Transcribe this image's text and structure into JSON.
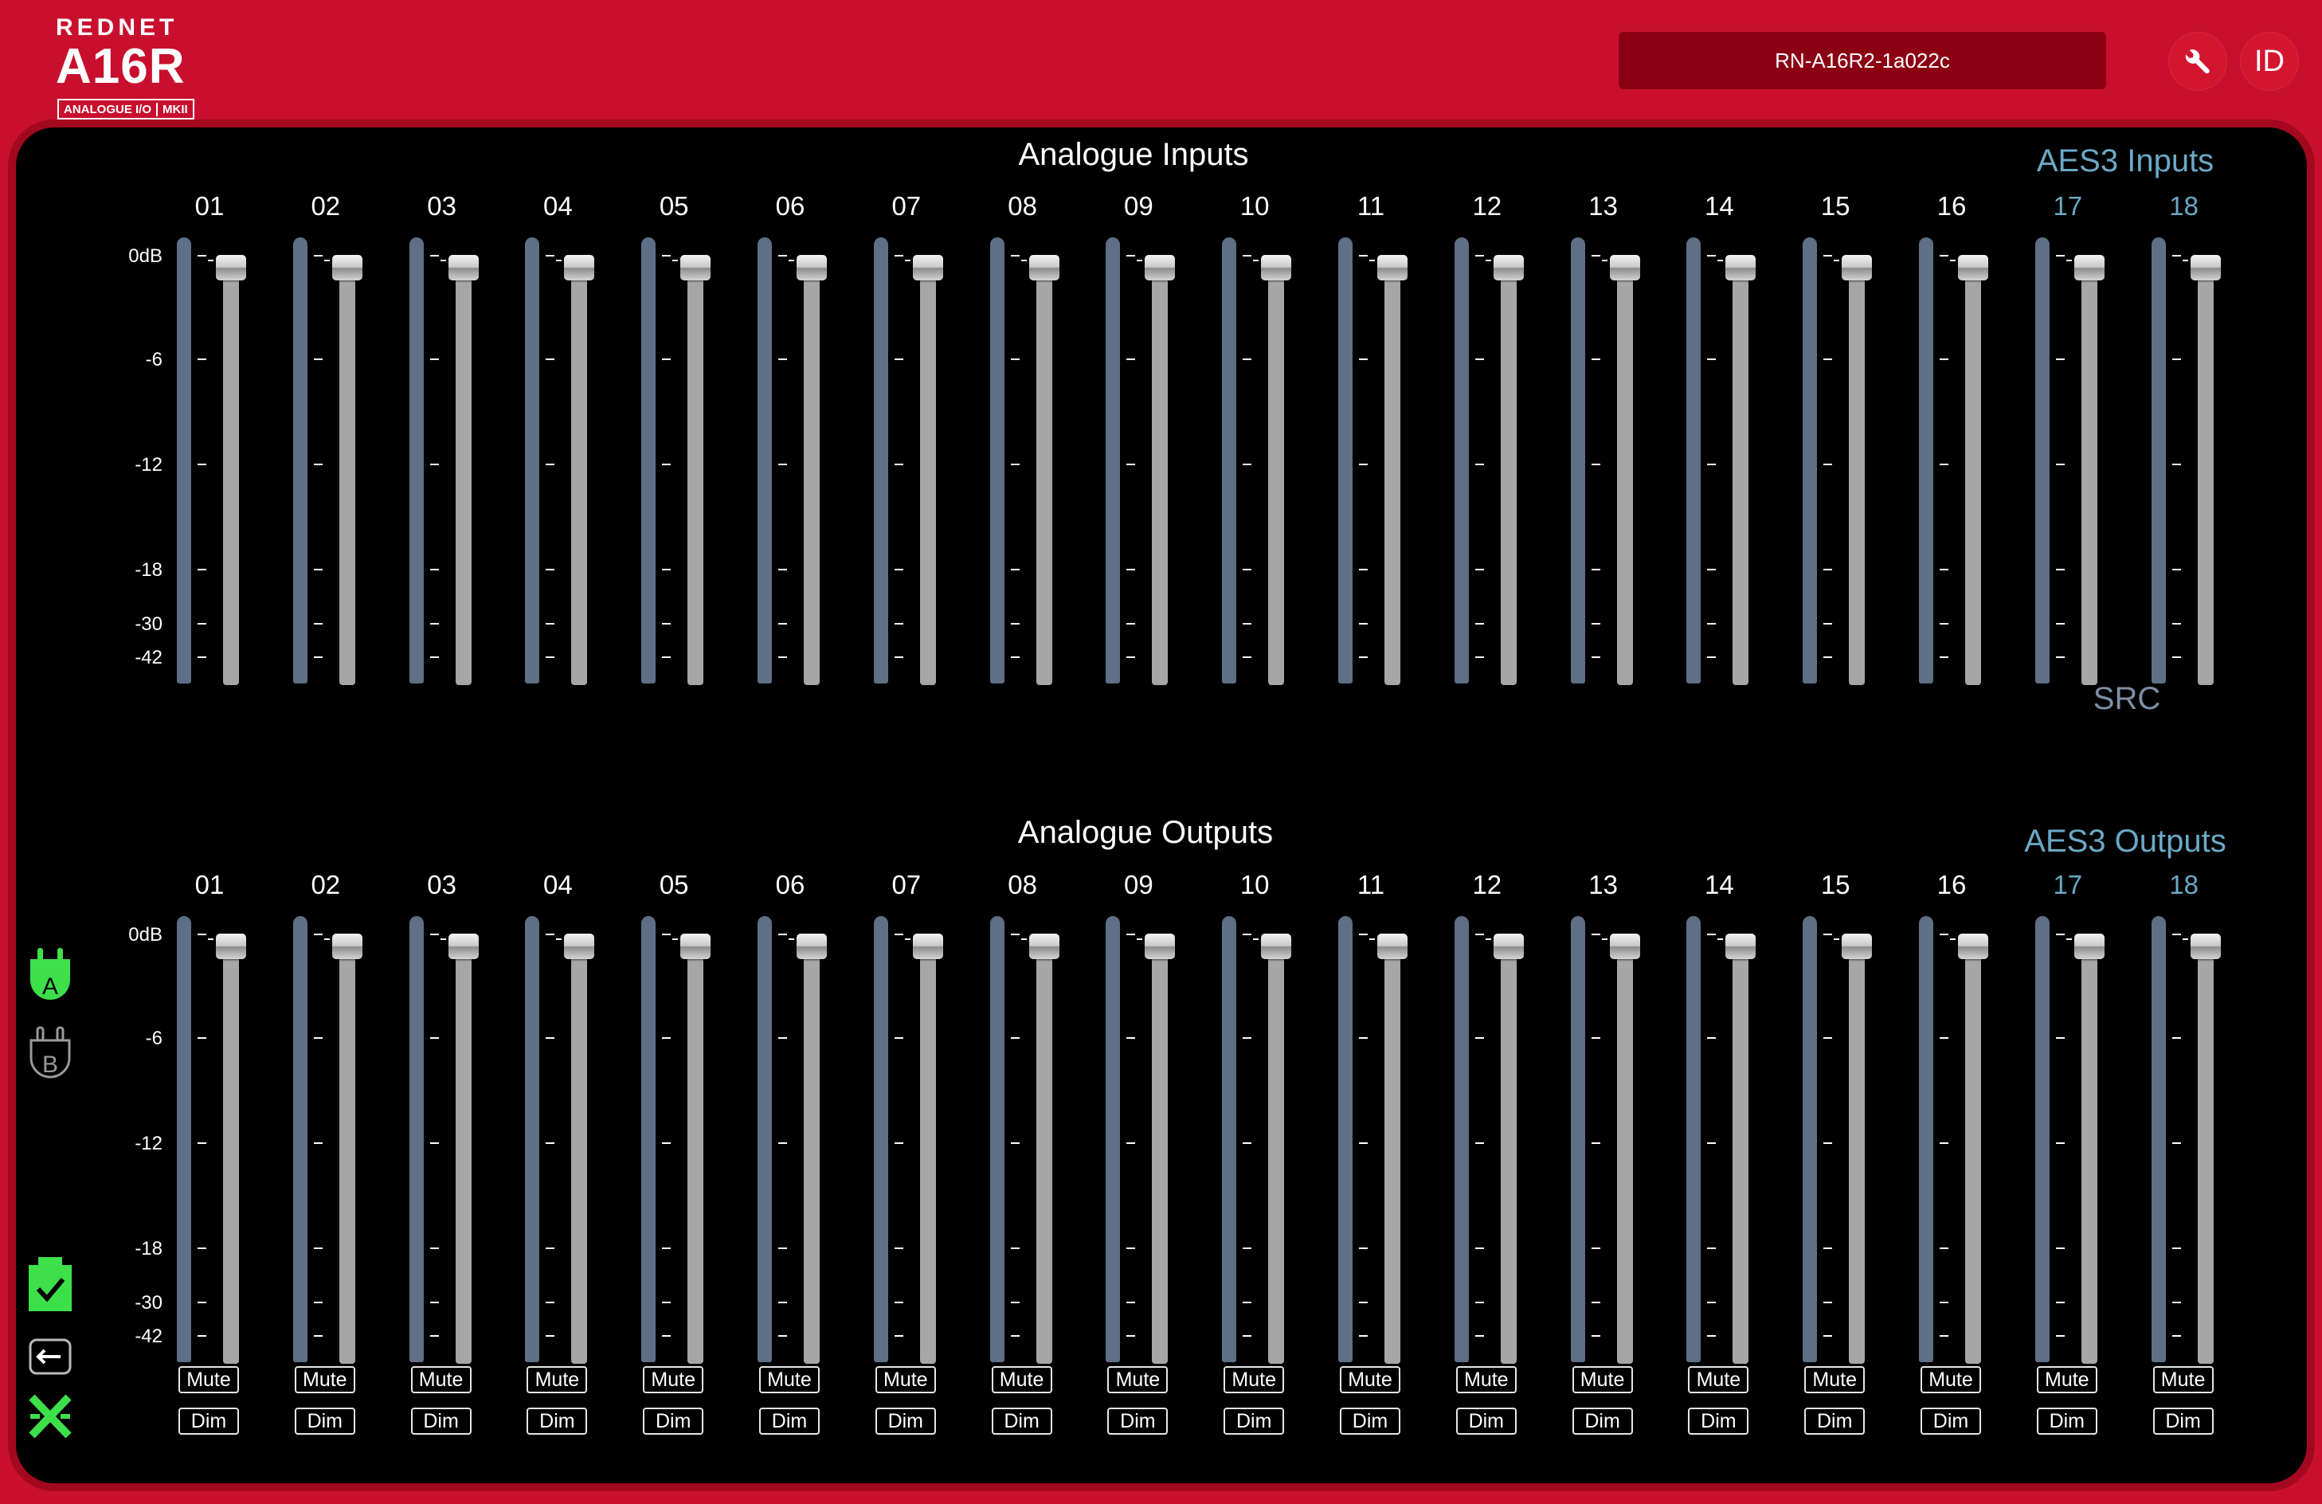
{
  "header": {
    "brand": "REDNET",
    "model": "A16R",
    "subtitle": "ANALOGUE I/O",
    "badge": "MKII",
    "device_name": "RN-A16R2-1a022c",
    "wrench_icon": "wrench-icon",
    "id_label": "ID"
  },
  "inputs": {
    "title": "Analogue Inputs",
    "aes_title": "AES3 Inputs",
    "src_label": "SRC",
    "channels": [
      "01",
      "02",
      "03",
      "04",
      "05",
      "06",
      "07",
      "08",
      "09",
      "10",
      "11",
      "12",
      "13",
      "14",
      "15",
      "16",
      "17",
      "18"
    ]
  },
  "outputs": {
    "title": "Analogue Outputs",
    "aes_title": "AES3 Outputs",
    "channels": [
      "01",
      "02",
      "03",
      "04",
      "05",
      "06",
      "07",
      "08",
      "09",
      "10",
      "11",
      "12",
      "13",
      "14",
      "15",
      "16",
      "17",
      "18"
    ],
    "mute_label": "Mute",
    "dim_label": "Dim"
  },
  "scale": [
    "0dB",
    "-6",
    "-12",
    "-18",
    "-30",
    "-42"
  ],
  "sidebar": {
    "network_a": "A",
    "network_b": "B",
    "icons": [
      "network-a-plug-icon",
      "network-b-plug-icon",
      "clock-lock-icon",
      "return-icon",
      "close-x-icon"
    ]
  },
  "colors": {
    "background": "#c8102e",
    "panel": "#000000",
    "meter": "#5e6f86",
    "aes_accent": "#6aa9c7",
    "status_green": "#3ee04a"
  }
}
